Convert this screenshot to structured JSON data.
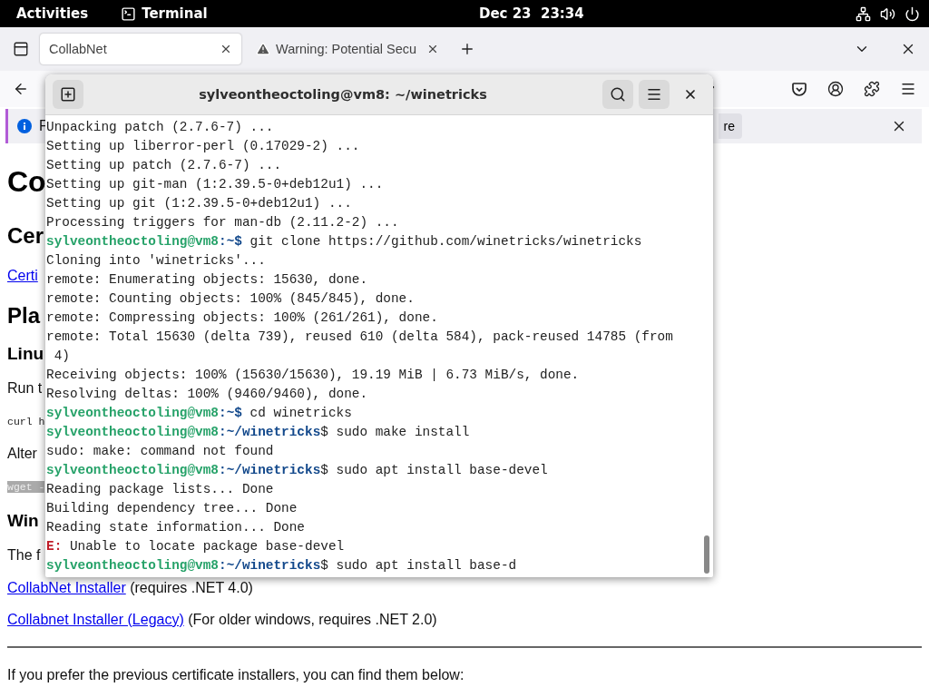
{
  "top_bar": {
    "activities": "Activities",
    "app": "Terminal",
    "clock": "Dec 23  23:34"
  },
  "browser": {
    "tabs": [
      {
        "title": "CollabNet",
        "selected": true,
        "warning": false
      },
      {
        "title": "Warning: Potential Secu",
        "selected": false,
        "warning": true
      }
    ],
    "notification": {
      "text": "F",
      "button": "re"
    },
    "page": [
      {
        "kind": "h1",
        "text": "Co"
      },
      {
        "kind": "h2",
        "text": "Cer"
      },
      {
        "kind": "link",
        "text": "Certi"
      },
      {
        "kind": "h2",
        "text": "Pla"
      },
      {
        "kind": "h3",
        "text": "Linu"
      },
      {
        "kind": "p",
        "text": "Run t"
      },
      {
        "kind": "code",
        "text": "curl h"
      },
      {
        "kind": "p",
        "text": "Alter"
      },
      {
        "kind": "highlight",
        "text": "wget -"
      },
      {
        "kind": "h3",
        "text": "Win"
      },
      {
        "kind": "p",
        "text": "The f"
      },
      {
        "kind": "linkline",
        "link": "CollabNet Installer",
        "text": "(requires .NET 4.0)"
      },
      {
        "kind": "linkline",
        "link": "Collabnet Installer (Legacy)",
        "text": "(For older windows, requires .NET 2.0)"
      },
      {
        "kind": "rule"
      },
      {
        "kind": "p",
        "text": "If you prefer the previous certificate installers, you can find them below:"
      }
    ]
  },
  "terminal": {
    "title": "sylveontheoctoling@vm8: ~/winetricks",
    "lines": [
      {
        "kind": "output",
        "text": "Unpacking patch (2.7.6-7) ..."
      },
      {
        "kind": "output",
        "text": "Setting up liberror-perl (0.17029-2) ..."
      },
      {
        "kind": "output",
        "text": "Setting up patch (2.7.6-7) ..."
      },
      {
        "kind": "output",
        "text": "Setting up git-man (1:2.39.5-0+deb12u1) ..."
      },
      {
        "kind": "output",
        "text": "Setting up git (1:2.39.5-0+deb12u1) ..."
      },
      {
        "kind": "output",
        "text": "Processing triggers for man-db (2.11.2-2) ..."
      },
      {
        "kind": "prompt",
        "user": "sylveontheoctoling@vm8",
        "path": ":~$",
        "command": " git clone https://github.com/winetricks/winetricks"
      },
      {
        "kind": "output",
        "text": "Cloning into 'winetricks'..."
      },
      {
        "kind": "output",
        "text": "remote: Enumerating objects: 15630, done."
      },
      {
        "kind": "output",
        "text": "remote: Counting objects: 100% (845/845), done."
      },
      {
        "kind": "output",
        "text": "remote: Compressing objects: 100% (261/261), done."
      },
      {
        "kind": "output",
        "text": "remote: Total 15630 (delta 739), reused 610 (delta 584), pack-reused 14785 (from"
      },
      {
        "kind": "output",
        "text": " 4)"
      },
      {
        "kind": "output",
        "text": "Receiving objects: 100% (15630/15630), 19.19 MiB | 6.73 MiB/s, done."
      },
      {
        "kind": "output",
        "text": "Resolving deltas: 100% (9460/9460), done."
      },
      {
        "kind": "prompt",
        "user": "sylveontheoctoling@vm8",
        "path": ":~$",
        "command": " cd winetricks"
      },
      {
        "kind": "prompt",
        "user": "sylveontheoctoling@vm8",
        "path": ":~/winetricks",
        "command": "$ sudo make install"
      },
      {
        "kind": "output",
        "text": "sudo: make: command not found"
      },
      {
        "kind": "prompt",
        "user": "sylveontheoctoling@vm8",
        "path": ":~/winetricks",
        "command": "$ sudo apt install base-devel"
      },
      {
        "kind": "output",
        "text": "Reading package lists... Done"
      },
      {
        "kind": "output",
        "text": "Building dependency tree... Done"
      },
      {
        "kind": "output",
        "text": "Reading state information... Done"
      },
      {
        "kind": "error",
        "label": "E:",
        "text": " Unable to locate package base-devel"
      },
      {
        "kind": "prompt",
        "user": "sylveontheoctoling@vm8",
        "path": ":~/winetricks",
        "command": "$ sudo apt install base-d"
      }
    ]
  }
}
